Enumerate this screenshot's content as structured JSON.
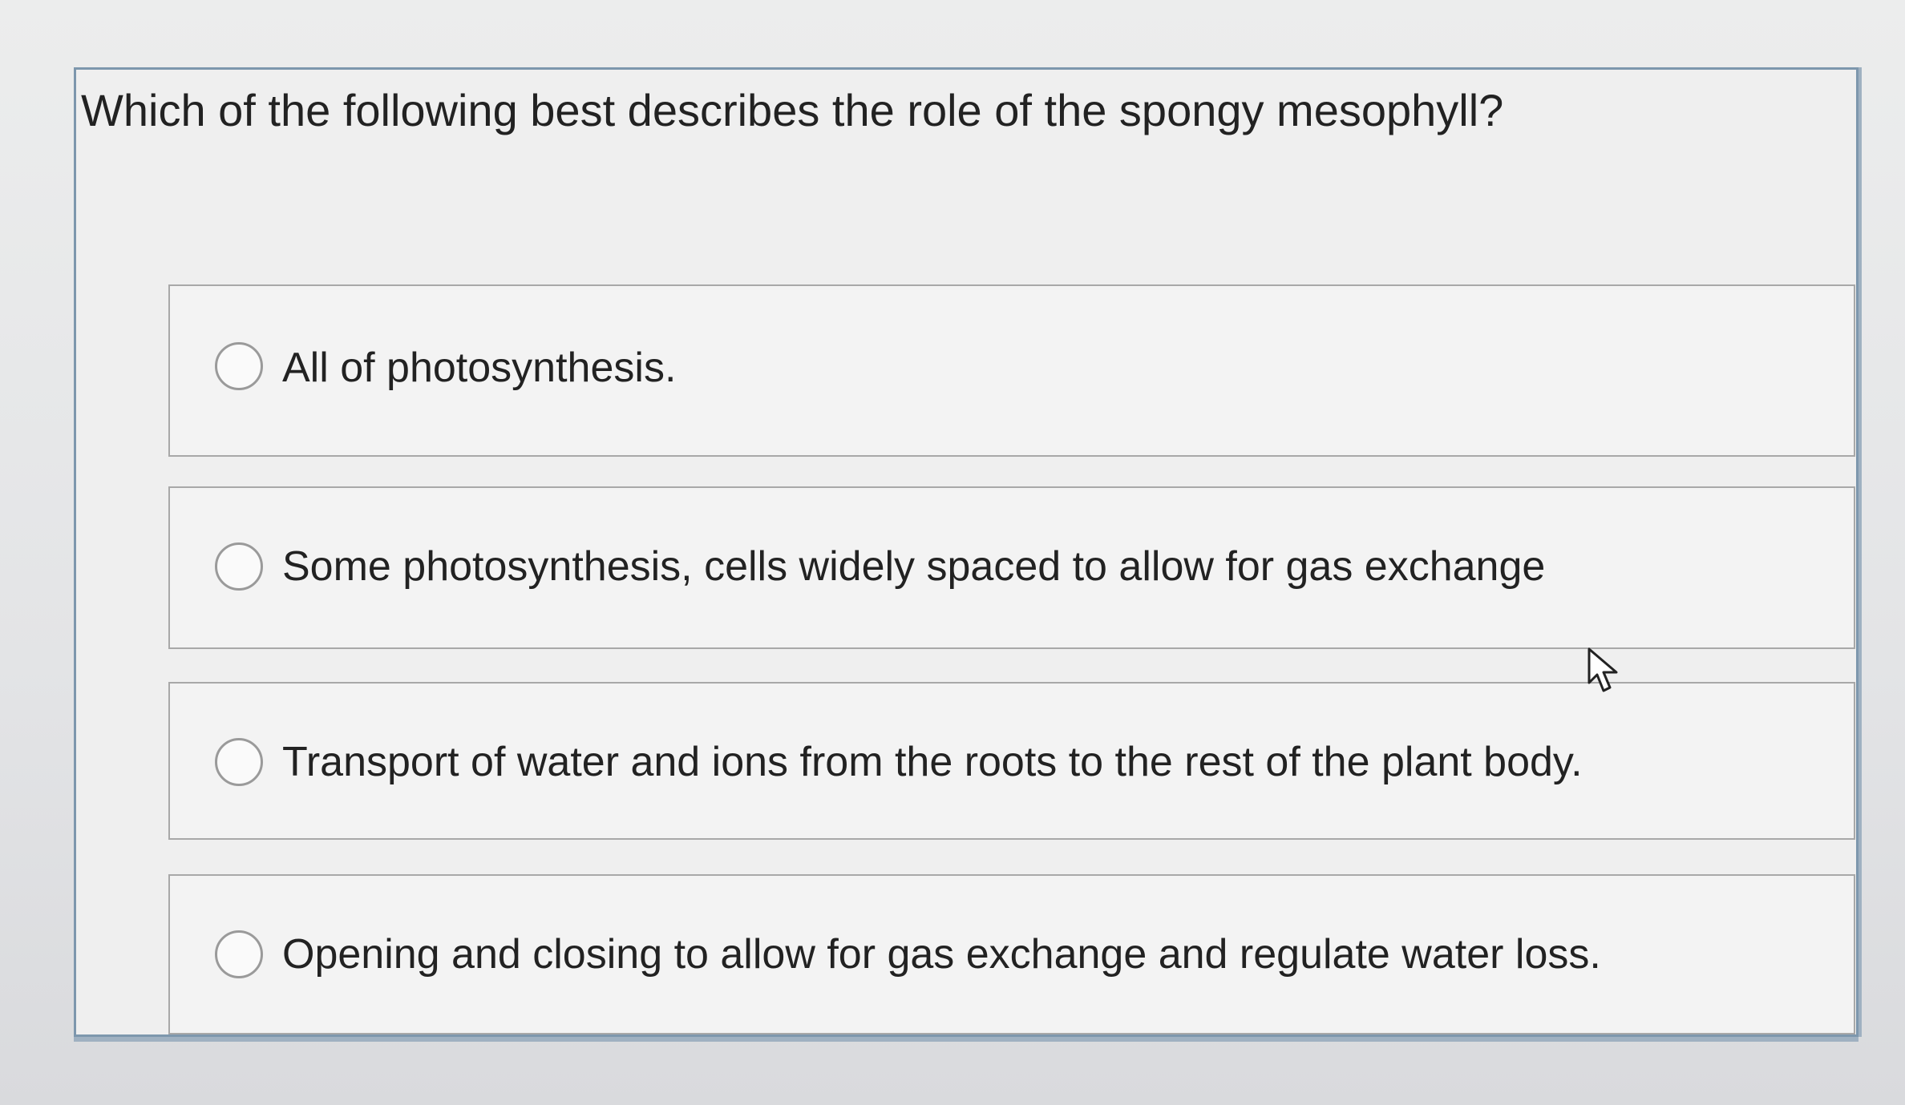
{
  "question": {
    "text": "Which of the following best describes the role of the spongy mesophyll?"
  },
  "options": [
    {
      "label": "All of photosynthesis.",
      "selected": false
    },
    {
      "label": "Some photosynthesis, cells widely spaced to allow for gas exchange",
      "selected": false
    },
    {
      "label": "Transport of water and ions from the roots to the rest of the plant body.",
      "selected": false
    },
    {
      "label": "Opening and closing to allow for gas exchange and regulate water loss.",
      "selected": false
    }
  ],
  "icons": {
    "radio": "radio-button-icon",
    "cursor": "mouse-pointer-icon"
  },
  "colors": {
    "card_border": "#7d97ad",
    "option_border": "#a8a8a8",
    "text": "#222222"
  }
}
